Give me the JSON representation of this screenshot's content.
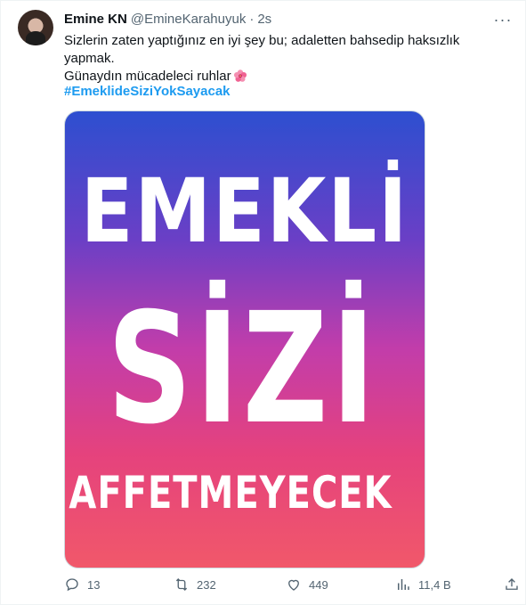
{
  "author": {
    "name": "Emine KN",
    "handle": "@EmineKarahuyuk",
    "separator": "·",
    "time": "2s"
  },
  "tweet": {
    "line1": "Sizlerin zaten yaptığınız en iyi şey bu; adaletten bahsedip haksızlık yapmak.",
    "line2": "Günaydın mücadeleci ruhlar",
    "emoji": "hibiscus-emoji",
    "hashtag": "#EmeklideSiziYokSayacak"
  },
  "image": {
    "word1": "EMEKLİ",
    "word2": "SİZİ",
    "word3": "AFFETMEYECEK",
    "gradient": [
      "#2d4fd0",
      "#6a3fc6",
      "#c23daa",
      "#e5427d",
      "#f1586a"
    ]
  },
  "actions": {
    "replies": "13",
    "retweets": "232",
    "likes": "449",
    "views": "11,4 B"
  },
  "colors": {
    "link": "#1d9bf0",
    "muted": "#536471",
    "text": "#0f1419"
  }
}
